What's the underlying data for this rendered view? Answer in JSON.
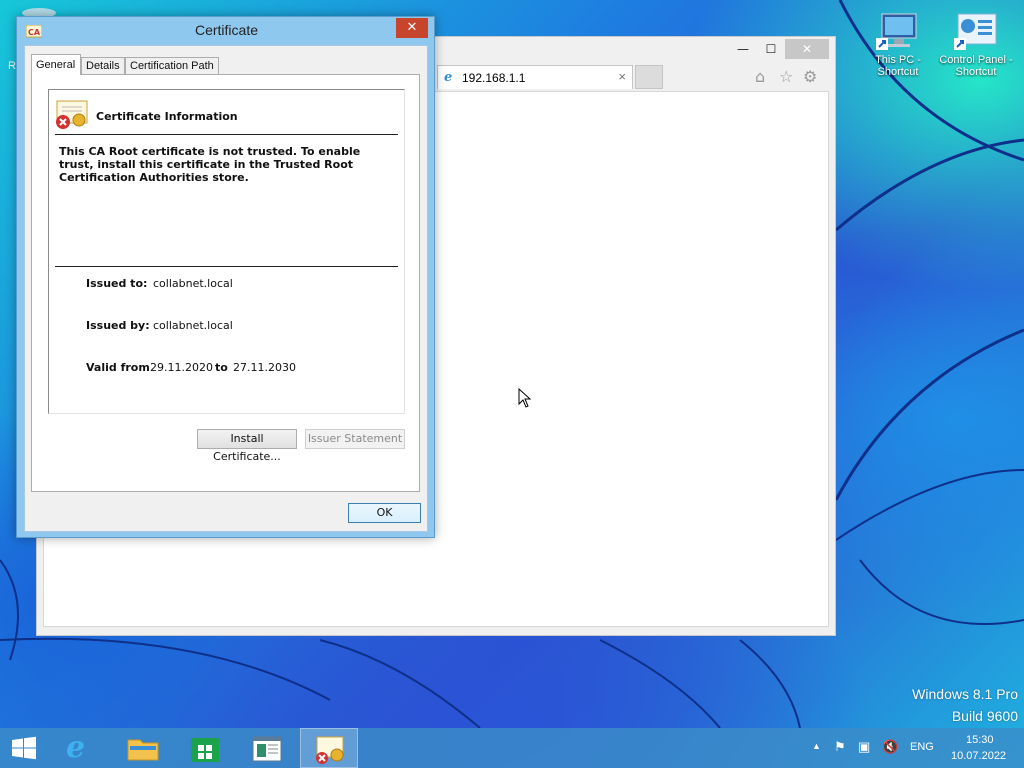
{
  "desktop": {
    "recycle_bin_label_fragment": "R",
    "icons": [
      {
        "label_line1": "This PC -",
        "label_line2": "Shortcut"
      },
      {
        "label_line1": "Control Panel -",
        "label_line2": "Shortcut"
      }
    ],
    "watermark": {
      "line1": "Windows 8.1 Pro",
      "line2": "Build 9600"
    }
  },
  "browser": {
    "tab_title": "192.168.1.1",
    "tab_close": "×",
    "controls": {
      "minimize": "—",
      "maximize": "☐",
      "close": "✕"
    },
    "tool_icons": [
      "home-icon",
      "favorites-star-icon",
      "settings-gear-icon"
    ]
  },
  "certificate_dialog": {
    "title": "Certificate",
    "close_glyph": "✕",
    "tabs": [
      "General",
      "Details",
      "Certification Path"
    ],
    "active_tab": "General",
    "info_heading": "Certificate Information",
    "warning": "This CA Root certificate is not trusted. To enable trust, install this certificate in the Trusted Root Certification Authorities store.",
    "issued_to_label": "Issued to:",
    "issued_to": "collabnet.local",
    "issued_by_label": "Issued by:",
    "issued_by": "collabnet.local",
    "valid_from_label": "Valid from",
    "valid_from": "29.11.2020",
    "valid_to_label": "to",
    "valid_to": "27.11.2030",
    "install_button": "Install Certificate...",
    "issuer_statement_button": "Issuer Statement",
    "ok_button": "OK"
  },
  "taskbar": {
    "items": [
      "start-icon",
      "internet-explorer-icon",
      "file-explorer-icon",
      "store-icon",
      "document-viewer-icon",
      "certificate-icon"
    ],
    "active_item": "certificate-icon",
    "language": "ENG",
    "time": "15:30",
    "date": "10.07.2022",
    "tray_icons": [
      "show-hidden-icons-chevron",
      "action-center-flag-icon",
      "network-icon",
      "volume-muted-icon"
    ]
  },
  "colors": {
    "dialog_frame": "#8fc8ef",
    "close_red": "#c7442d",
    "taskbar": "#3c8cc8"
  }
}
